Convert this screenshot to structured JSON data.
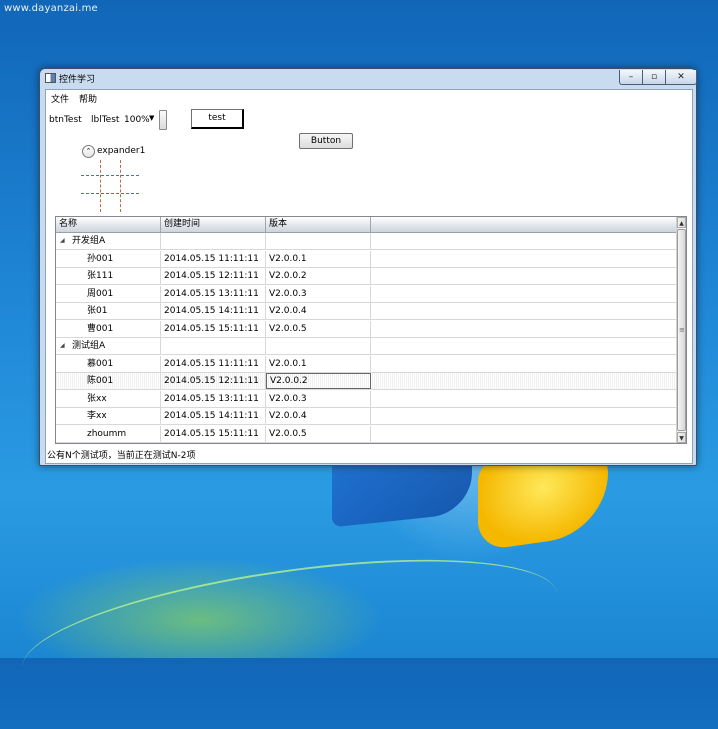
{
  "watermark": "www.dayanzai.me",
  "window": {
    "title": "控件学习",
    "controls": {
      "minimize": "–",
      "maximize": "▫",
      "close": "✕"
    }
  },
  "menu": [
    "文件",
    "帮助"
  ],
  "toolbar": {
    "btn_label": "btnTest",
    "lbl_label": "lblTest",
    "zoom": "100%",
    "test_button": "test"
  },
  "button_label": "Button",
  "expander": {
    "label": "expander1",
    "toggle_glyph": "⌃"
  },
  "grid": {
    "columns": [
      "名称",
      "创建时间",
      "版本"
    ],
    "groups": [
      {
        "name": "开发组A",
        "rows": [
          {
            "name": "孙001",
            "time": "2014.05.15 11:11:11",
            "version": "V2.0.0.1"
          },
          {
            "name": "张111",
            "time": "2014.05.15 12:11:11",
            "version": "V2.0.0.2"
          },
          {
            "name": "周001",
            "time": "2014.05.15 13:11:11",
            "version": "V2.0.0.3"
          },
          {
            "name": "张01",
            "time": "2014.05.15 14:11:11",
            "version": "V2.0.0.4"
          },
          {
            "name": "曹001",
            "time": "2014.05.15 15:11:11",
            "version": "V2.0.0.5"
          }
        ]
      },
      {
        "name": "测试组A",
        "rows": [
          {
            "name": "慕001",
            "time": "2014.05.15 11:11:11",
            "version": "V2.0.0.1"
          },
          {
            "name": "陈001",
            "time": "2014.05.15 12:11:11",
            "version": "V2.0.0.2",
            "selected": true
          },
          {
            "name": "张xx",
            "time": "2014.05.15 13:11:11",
            "version": "V2.0.0.3"
          },
          {
            "name": "李xx",
            "time": "2014.05.15 14:11:11",
            "version": "V2.0.0.4"
          },
          {
            "name": "zhoumm",
            "time": "2014.05.15 15:11:11",
            "version": "V2.0.0.5"
          }
        ]
      }
    ],
    "scroll": {
      "up": "▲",
      "down": "▼",
      "grip": "≡"
    },
    "group_arrow": "◢"
  },
  "status_text": "公有N个测试项，当前正在测试N-2项",
  "colors": {
    "titlebar": "#c9dcef",
    "desktop": "#1f86d6",
    "border": "#3c4f66"
  }
}
